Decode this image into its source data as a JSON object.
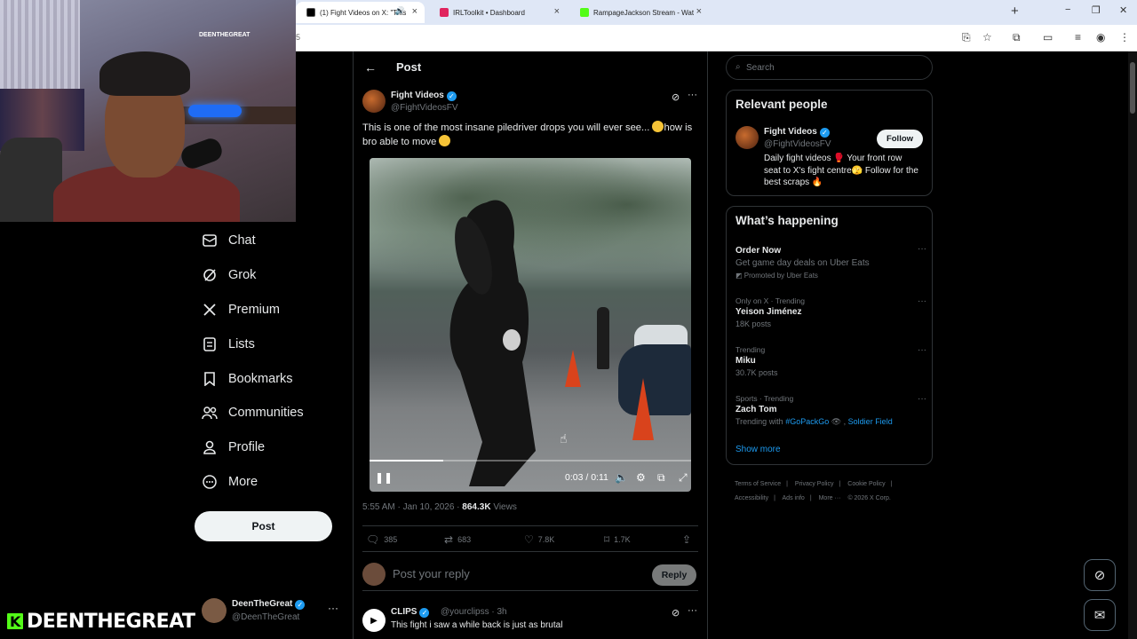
{
  "browser": {
    "tabs": [
      {
        "title": "(1) Fight Videos on X: \"This",
        "active": true,
        "color": "#000000"
      },
      {
        "title": "IRLToolkit • Dashboard",
        "active": false,
        "color": "#e0245e"
      },
      {
        "title": "RampageJackson Stream - Wat",
        "active": false,
        "color": "#53fc18"
      }
    ],
    "address_fragment": "5",
    "new_tab": "+",
    "win_min": "−",
    "win_max": "❐",
    "win_close": "✕"
  },
  "page": {
    "header_title": "Post",
    "back_icon": "←"
  },
  "nav": {
    "items": [
      {
        "label": "Chat",
        "icon": "chat-icon"
      },
      {
        "label": "Grok",
        "icon": "grok-icon"
      },
      {
        "label": "Premium",
        "icon": "x-logo-icon"
      },
      {
        "label": "Lists",
        "icon": "lists-icon"
      },
      {
        "label": "Bookmarks",
        "icon": "bookmark-icon"
      },
      {
        "label": "Communities",
        "icon": "communities-icon"
      },
      {
        "label": "Profile",
        "icon": "profile-icon"
      },
      {
        "label": "More",
        "icon": "more-circle-icon"
      }
    ],
    "post_button": "Post",
    "account_name": "DeenTheGreat",
    "account_handle": "@DeenTheGreat"
  },
  "post": {
    "author_name": "Fight Videos",
    "author_handle": "@FightVideosFV",
    "text_part1": "This is one of the most insane piledriver drops you will ever see...",
    "text_part2": "how is bro able to move",
    "video_time": "0:03 / 0:11",
    "video_progress": 0.23,
    "timestamp": "5:55 AM · Jan 10, 2026 · ",
    "views_count": "864.3K",
    "views_label": " Views",
    "stats": {
      "replies": "385",
      "reposts": "683",
      "likes": "7.8K",
      "bookmarks": "1.7K"
    },
    "reply_placeholder": "Post your reply",
    "reply_button": "Reply"
  },
  "reply_preview": {
    "name": "CLIPS",
    "handle": "@yourclipss · 3h",
    "text": "This fight i saw a while back is just as brutal"
  },
  "sidebar": {
    "search_placeholder": "Search",
    "relevant_title": "Relevant people",
    "relevant": {
      "name": "Fight Videos",
      "handle": "@FightVideosFV",
      "follow": "Follow",
      "bio": "Daily fight videos 🥊 Your front row seat to X's fight centre🫣 Follow for the best scraps 🔥"
    },
    "happening_title": "What’s happening",
    "trends": [
      {
        "context": "",
        "title": "Order Now",
        "sub": "Get game day deals on Uber Eats",
        "sub2": "Promoted by Uber Eats"
      },
      {
        "context": "Only on X · Trending",
        "title": "Yeison Jiménez",
        "sub": "18K posts",
        "sub2": ""
      },
      {
        "context": "Trending",
        "title": "Miku",
        "sub": "30.7K posts",
        "sub2": ""
      },
      {
        "context": "Sports · Trending",
        "title": "Zach Tom",
        "sub": "Trending with ",
        "tag1": "#GoPackGo",
        "tag2": "Soldier Field"
      }
    ],
    "show_more": "Show more",
    "footer": [
      "Terms of Service",
      "|",
      "Privacy Policy",
      "|",
      "Cookie Policy",
      "|",
      "Accessibility",
      "|",
      "Ads info",
      "|",
      "More ···",
      "© 2026 X Corp."
    ]
  },
  "overlay": {
    "streamer_tag": "DEENTHEGREAT",
    "kick_letter": "K",
    "wall_sign": "DEENTHEGREAT"
  },
  "colors": {
    "accent": "#1d9bf0",
    "kick_green": "#53fc18"
  }
}
